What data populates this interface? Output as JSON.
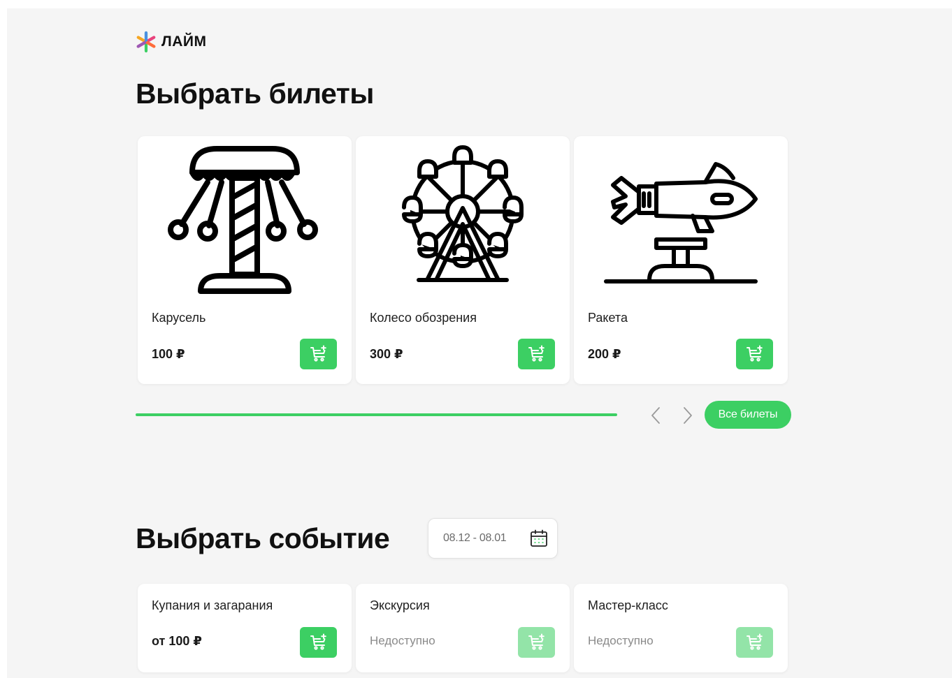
{
  "brand": {
    "name": "ЛАЙМ",
    "logo_icon": "lime-star-logo-icon",
    "logo_colors": [
      "#3ccf63",
      "#f5a623",
      "#e8427c",
      "#4a90e2",
      "#9b59b6",
      "#ff6b3d"
    ]
  },
  "tickets_section": {
    "title": "Выбрать билеты",
    "items": [
      {
        "name": "Карусель",
        "price": "100 ₽",
        "icon": "carousel-icon",
        "cart_icon": "cart-add-icon"
      },
      {
        "name": "Колесо обозрения",
        "price": "300 ₽",
        "icon": "ferris-wheel-icon",
        "cart_icon": "cart-add-icon"
      },
      {
        "name": "Ракета",
        "price": "200 ₽",
        "icon": "rocket-ride-icon",
        "cart_icon": "cart-add-icon"
      }
    ],
    "carousel_progress": 1.0,
    "prev_icon": "chevron-left-icon",
    "next_icon": "chevron-right-icon",
    "all_button_label": "Все билеты"
  },
  "events_section": {
    "title": "Выбрать событие",
    "date_range": "08.12 - 08.01",
    "calendar_icon": "calendar-icon",
    "items": [
      {
        "name": "Купания и загарания",
        "price": "от 100 ₽",
        "available": true
      },
      {
        "name": "Экскурсия",
        "price": "Недоступно",
        "available": false
      },
      {
        "name": "Мастер-класс",
        "price": "Недоступно",
        "available": false
      }
    ]
  },
  "colors": {
    "accent": "#3ccf63",
    "accent_disabled": "#93e4a8",
    "background": "#f5f5f5",
    "card": "#ffffff"
  }
}
